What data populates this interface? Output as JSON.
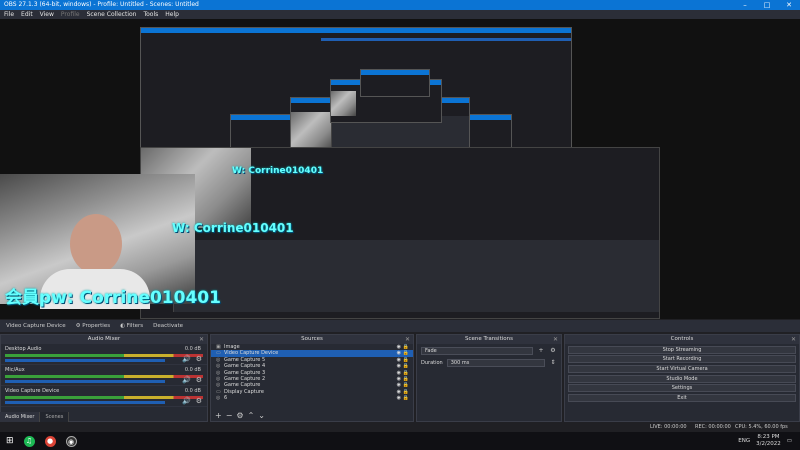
{
  "titlebar": {
    "title": "OBS 27.1.3 (64-bit, windows) - Profile: Untitled - Scenes: Untitled",
    "min_icon": "minimize-icon",
    "max_icon": "maximize-icon",
    "close_icon": "close-icon"
  },
  "menu": {
    "items": [
      "File",
      "Edit",
      "View",
      "Profile",
      "Scene Collection",
      "Tools",
      "Help"
    ]
  },
  "preview": {
    "overlay_text": "会員pw: Corrine010401",
    "overlay_text_mid": "W: Corrine010401",
    "overlay_text_small": "W: Corrine010401"
  },
  "source_bar": {
    "source_name": "Video Capture Device",
    "properties": "Properties",
    "filters": "Filters",
    "deactivate": "Deactivate"
  },
  "mixer": {
    "title": "Audio Mixer",
    "channels": [
      {
        "name": "Desktop Audio",
        "db": "0.0 dB"
      },
      {
        "name": "Mic/Aux",
        "db": "0.0 dB"
      },
      {
        "name": "Video Capture Device",
        "db": "0.0 dB"
      }
    ],
    "tabs": [
      "Audio Mixer",
      "Scenes"
    ]
  },
  "sources": {
    "title": "Sources",
    "items": [
      "Image",
      "Video Capture Device",
      "Game Capture 5",
      "Game Capture 4",
      "Game Capture 3",
      "Game Capture 2",
      "Game Capture",
      "Display Capture",
      "6"
    ],
    "tools": [
      "+",
      "−",
      "⚙",
      "⌃",
      "⌄"
    ]
  },
  "transitions": {
    "title": "Scene Transitions",
    "transition": "Fade",
    "duration_label": "Duration",
    "duration_value": "300 ms"
  },
  "controls": {
    "title": "Controls",
    "buttons": [
      "Stop Streaming",
      "Start Recording",
      "Start Virtual Camera",
      "Studio Mode",
      "Settings",
      "Exit"
    ]
  },
  "status": {
    "live": "LIVE: 00:00:00",
    "rec": "REC: 00:00:00",
    "cpu": "CPU: 5.4%, 60.00 fps"
  },
  "taskbar": {
    "lang": "ENG",
    "time": "8:23 PM",
    "date": "3/2/2022"
  },
  "colors": {
    "accent": "#0b74d4",
    "selected": "#1f5fb3",
    "overlay": "#66ffff"
  }
}
